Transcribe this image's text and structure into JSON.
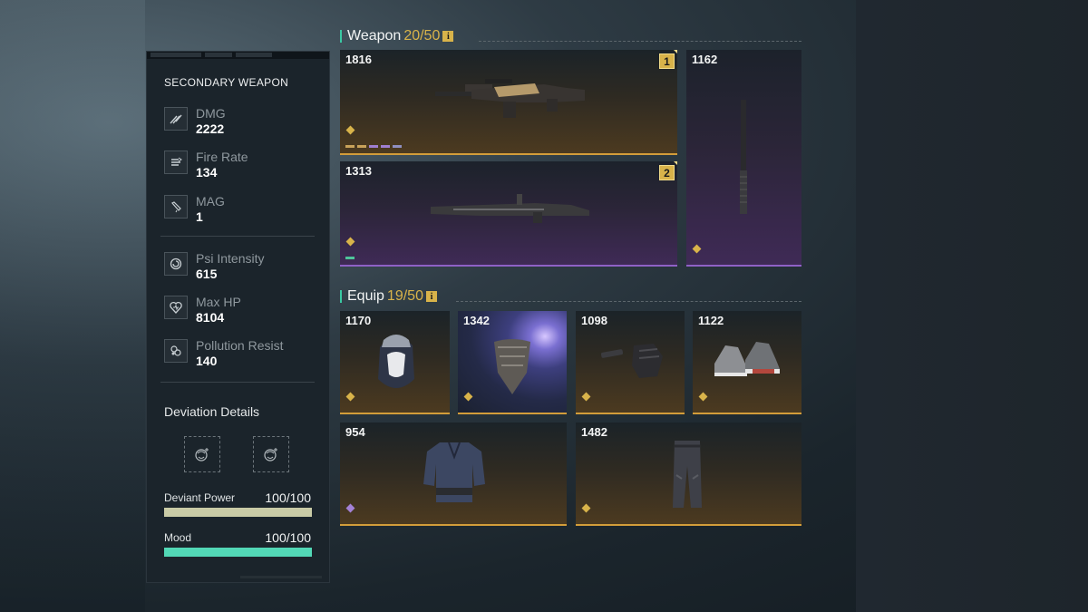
{
  "info": {
    "title": "SECONDARY WEAPON",
    "stats": [
      {
        "label": "DMG",
        "value": "2222",
        "icon": "damage-icon"
      },
      {
        "label": "Fire Rate",
        "value": "134",
        "icon": "fire-rate-icon"
      },
      {
        "label": "MAG",
        "value": "1",
        "icon": "magazine-icon"
      },
      {
        "label": "Psi Intensity",
        "value": "615",
        "icon": "psi-intensity-icon"
      },
      {
        "label": "Max HP",
        "value": "8104",
        "icon": "heart-icon"
      },
      {
        "label": "Pollution Resist",
        "value": "140",
        "icon": "pollution-resist-icon"
      }
    ],
    "deviation": {
      "title": "Deviation Details",
      "icons": [
        "deviant-slot-1-icon",
        "deviant-slot-2-icon"
      ],
      "bars": [
        {
          "label": "Deviant Power",
          "value": "100/100",
          "fraction": 1.0,
          "color": "#c9cba6"
        },
        {
          "label": "Mood",
          "value": "100/100",
          "fraction": 1.0,
          "color": "#52d8b6"
        }
      ]
    }
  },
  "weapon": {
    "label": "Weapon",
    "count": "20/50",
    "info": "i",
    "cards": [
      {
        "power": "1816",
        "slot": "1",
        "rarity": "gold",
        "item": "assault-rifle"
      },
      {
        "power": "1313",
        "slot": "2",
        "rarity": "purple",
        "item": "crossbow"
      },
      {
        "power": "1162",
        "rarity": "purple",
        "item": "melee-baton"
      }
    ]
  },
  "equip": {
    "label": "Equip",
    "count": "19/50",
    "info": "i",
    "cards": [
      {
        "power": "1170",
        "rarity": "gold",
        "item": "hooded-cap"
      },
      {
        "power": "1342",
        "rarity": "gold",
        "item": "face-mask"
      },
      {
        "power": "1098",
        "rarity": "gold",
        "item": "gloves"
      },
      {
        "power": "1122",
        "rarity": "gold",
        "item": "sneakers"
      },
      {
        "power": "954",
        "rarity": "purple",
        "item": "jacket"
      },
      {
        "power": "1482",
        "rarity": "gold",
        "item": "pants"
      }
    ]
  }
}
